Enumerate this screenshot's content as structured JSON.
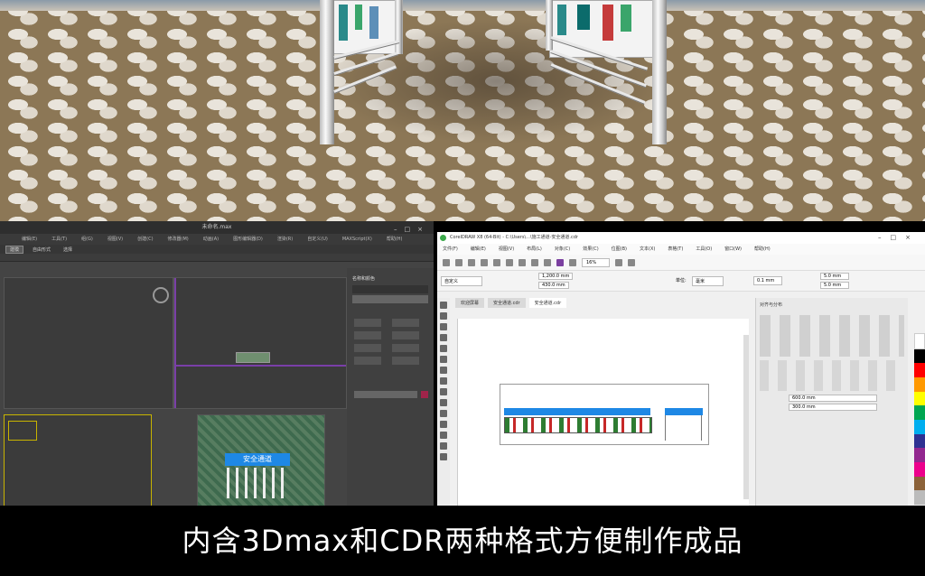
{
  "render": {
    "label": "3D render of safety tunnel on paved ground"
  },
  "max_window": {
    "title": "未命名.max",
    "menus": [
      "编辑(E)",
      "工具(T)",
      "组(G)",
      "视图(V)",
      "创建(C)",
      "修改器(M)",
      "动画(A)",
      "图形编辑器(D)",
      "渲染(R)",
      "自定义(U)",
      "MAXScript(X)",
      "帮助(H)"
    ],
    "tabs": [
      "建模",
      "自由形式",
      "选择"
    ],
    "active_tab": "建模",
    "cmd_title": "名称和颜色",
    "sign_text": "安全通道",
    "accent_color": "#c8b400"
  },
  "cdr_window": {
    "title": "CorelDRAW X8 (64-Bit) - C:\\Users\\...\\施工通道-安全通道.cdr",
    "menus": [
      "文件(F)",
      "编辑(E)",
      "视图(V)",
      "布局(L)",
      "对象(C)",
      "效果(C)",
      "位图(B)",
      "文本(X)",
      "表格(T)",
      "工具(O)",
      "窗口(W)",
      "帮助(H)"
    ],
    "zoom": "16%",
    "size_w": "1,200.0 mm",
    "size_h": "430.0 mm",
    "unit_label": "单位:",
    "unit_value": "毫米",
    "nudge": "0.1 mm",
    "dup_x": "5.0 mm",
    "dup_y": "5.0 mm",
    "paper": "自定义",
    "doc_tabs": [
      "欢迎屏幕",
      "安全通道.cdr",
      "安全通道.cdr"
    ],
    "active_doc": 2,
    "dock_title": "对齐与分布",
    "dock_x": "600.0 mm",
    "dock_y": "300.0 mm",
    "palette_colors": [
      "#ffffff",
      "#000000",
      "#ff0000",
      "#ff9900",
      "#ffff00",
      "#00a651",
      "#00aeef",
      "#2e3192",
      "#92278f",
      "#ec008c",
      "#8c6239",
      "#bbbbbb"
    ],
    "sign_color": "#1e88e5"
  },
  "caption": "内含3Dmax和CDR两种格式方便制作成品"
}
